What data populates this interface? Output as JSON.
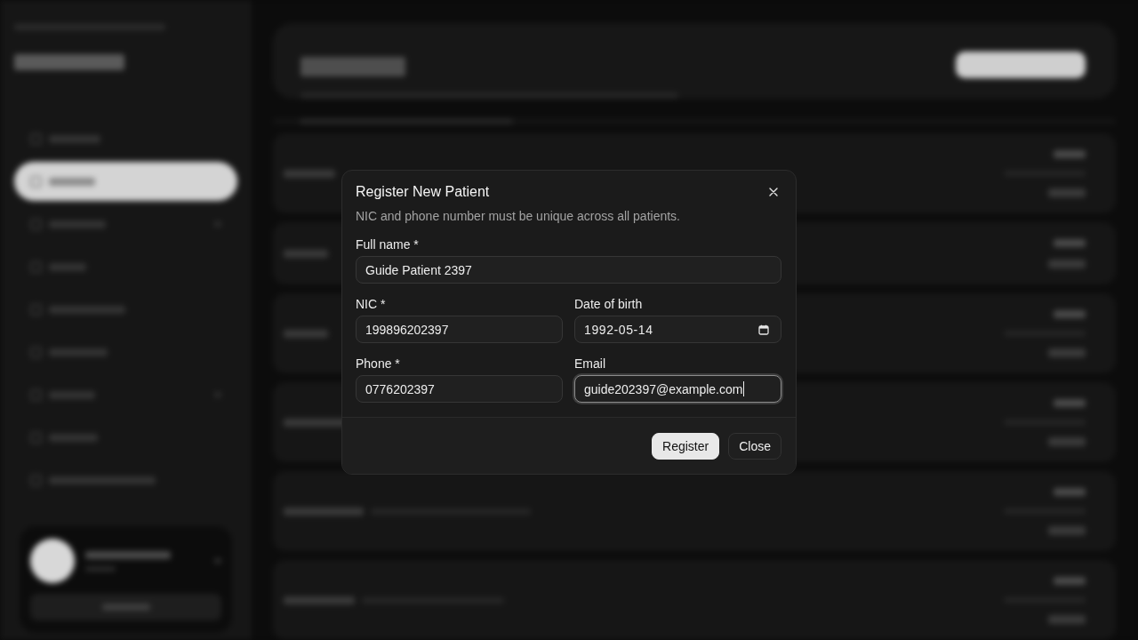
{
  "dialog": {
    "title": "Register New Patient",
    "note": "NIC and phone number must be unique across all patients.",
    "field_rows": [
      {
        "fields": [
          {
            "label": "Full name *",
            "value": "Guide Patient 2397",
            "kind": "text",
            "focused": false
          }
        ]
      },
      {
        "fields": [
          {
            "label": "NIC *",
            "value": "199896202397",
            "kind": "text",
            "focused": false
          },
          {
            "label": "Date of birth",
            "value": "1992-05-14",
            "kind": "date",
            "focused": false
          }
        ]
      },
      {
        "fields": [
          {
            "label": "Phone *",
            "value": "0776202397",
            "kind": "text",
            "focused": false
          },
          {
            "label": "Email",
            "value": "guide202397@example.com",
            "kind": "text",
            "focused": true
          }
        ]
      }
    ],
    "buttons": [
      {
        "label": "Register",
        "kind": "primary"
      },
      {
        "label": "Close",
        "kind": "secondary"
      }
    ]
  }
}
